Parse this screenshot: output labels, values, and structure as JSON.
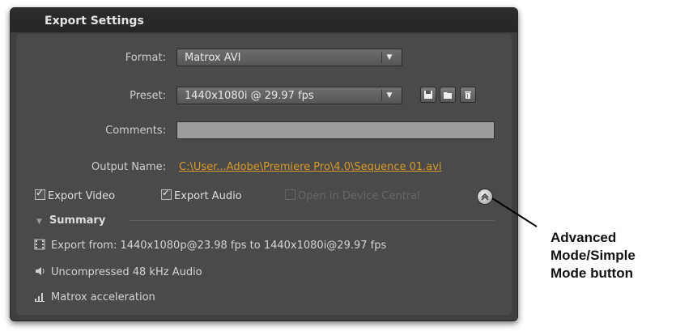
{
  "panel": {
    "title": "Export Settings"
  },
  "format": {
    "label": "Format:",
    "value": "Matrox AVI"
  },
  "preset": {
    "label": "Preset:",
    "value": "1440x1080i @ 29.97 fps",
    "buttons": [
      "save-preset-icon",
      "import-preset-icon",
      "delete-preset-icon"
    ]
  },
  "comments": {
    "label": "Comments:",
    "value": ""
  },
  "output": {
    "label": "Output Name:",
    "value": "C:\\User...Adobe\\Premiere Pro\\4.0\\Sequence 01.avi"
  },
  "options": {
    "export_video": {
      "label": "Export Video",
      "checked": true
    },
    "export_audio": {
      "label": "Export Audio",
      "checked": true
    },
    "device_central": {
      "label": "Open in Device Central",
      "checked": false,
      "enabled": false
    }
  },
  "summary": {
    "title": "Summary",
    "items": [
      {
        "icon": "film-icon",
        "text": "Export from: 1440x1080p@23.98 fps to 1440x1080i@29.97 fps"
      },
      {
        "icon": "speaker-icon",
        "text": "Uncompressed 48 kHz Audio"
      },
      {
        "icon": "bar-chart-icon",
        "text": "Matrox acceleration"
      }
    ]
  },
  "callout": {
    "lines": [
      "Advanced",
      "Mode/Simple",
      "Mode button"
    ]
  },
  "colors": {
    "panel_bg": "#4a4a4a",
    "link": "#d79b2b",
    "header_bg": "#2d2d2d"
  }
}
